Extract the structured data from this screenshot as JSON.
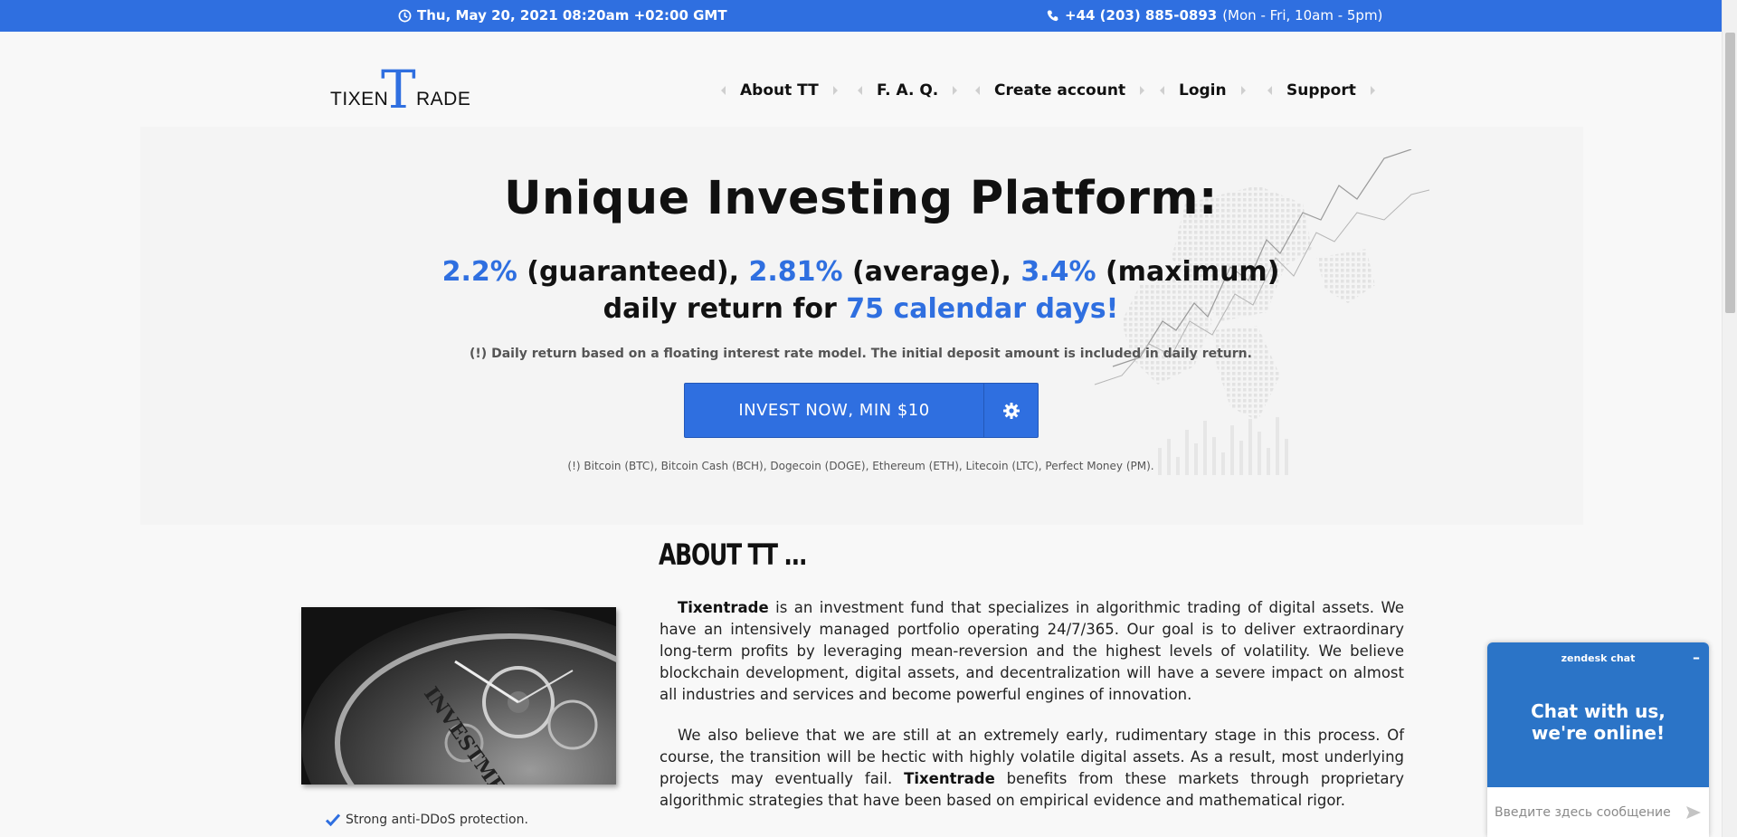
{
  "topbar": {
    "datetime": "Thu, May 20, 2021 08:20am +02:00 GMT",
    "phone": "+44 (203) 885-0893",
    "hours": "(Mon - Fri, 10am - 5pm)",
    "icons": [
      "clock-icon",
      "phone-icon"
    ]
  },
  "logo": {
    "left": "TIXEN",
    "t": "T",
    "right": "RADE"
  },
  "nav": [
    {
      "label": "About TT"
    },
    {
      "label": "F. A. Q."
    },
    {
      "label": "Create account"
    },
    {
      "label": "Login"
    },
    {
      "label": "Support"
    }
  ],
  "hero": {
    "title": "Unique Investing Platform:",
    "rate_guaranteed": "2.2%",
    "label_guaranteed": "(guaranteed),",
    "rate_average": "2.81%",
    "label_average": "(average),",
    "rate_maximum": "3.4%",
    "label_maximum": "(maximum)",
    "line2_prefix": "daily return for",
    "days": "75 calendar days!",
    "note": "(!) Daily return based on a floating interest rate model. The initial deposit amount is included in daily return.",
    "invest_button": "INVEST NOW, MIN $10",
    "crypto_note": "(!) Bitcoin (BTC), Bitcoin Cash (BCH), Dogecoin (DOGE), Ethereum (ETH), Litecoin (LTC), Perfect Money (PM)."
  },
  "about": {
    "heading": "ABOUT TT ...",
    "p1_brand": "Tixentrade",
    "p1_text": " is an investment fund that specializes in algorithmic trading of digital assets. We have an intensively managed portfolio operating 24/7/365. Our goal is to deliver extraordinary long-term profits by leveraging mean-reversion and the highest levels of volatility. We believe blockchain development, digital assets, and decentralization will have a severe impact on almost all industries and services and become powerful engines of innovation.",
    "p2_text_a": "We also believe that we are still at an extremely early, rudimentary stage in this process. Of course, the transition will be hectic with highly volatile digital assets. As a result, most underlying projects may eventually fail. ",
    "p2_brand": "Tixentrade",
    "p2_text_b": " benefits from these markets through proprietary algorithmic strategies that have been based on empirical evidence and mathematical rigor.",
    "photo_text": "INVESTMENT",
    "feature": "Strong anti-DDoS protection."
  },
  "chat": {
    "brand": "zendesk chat",
    "minimize": "–",
    "message": "Chat with us, we're online!",
    "placeholder": "Введите здесь сообщение"
  },
  "colors": {
    "accent": "#2f6fe0",
    "chat": "#2b74c7"
  }
}
